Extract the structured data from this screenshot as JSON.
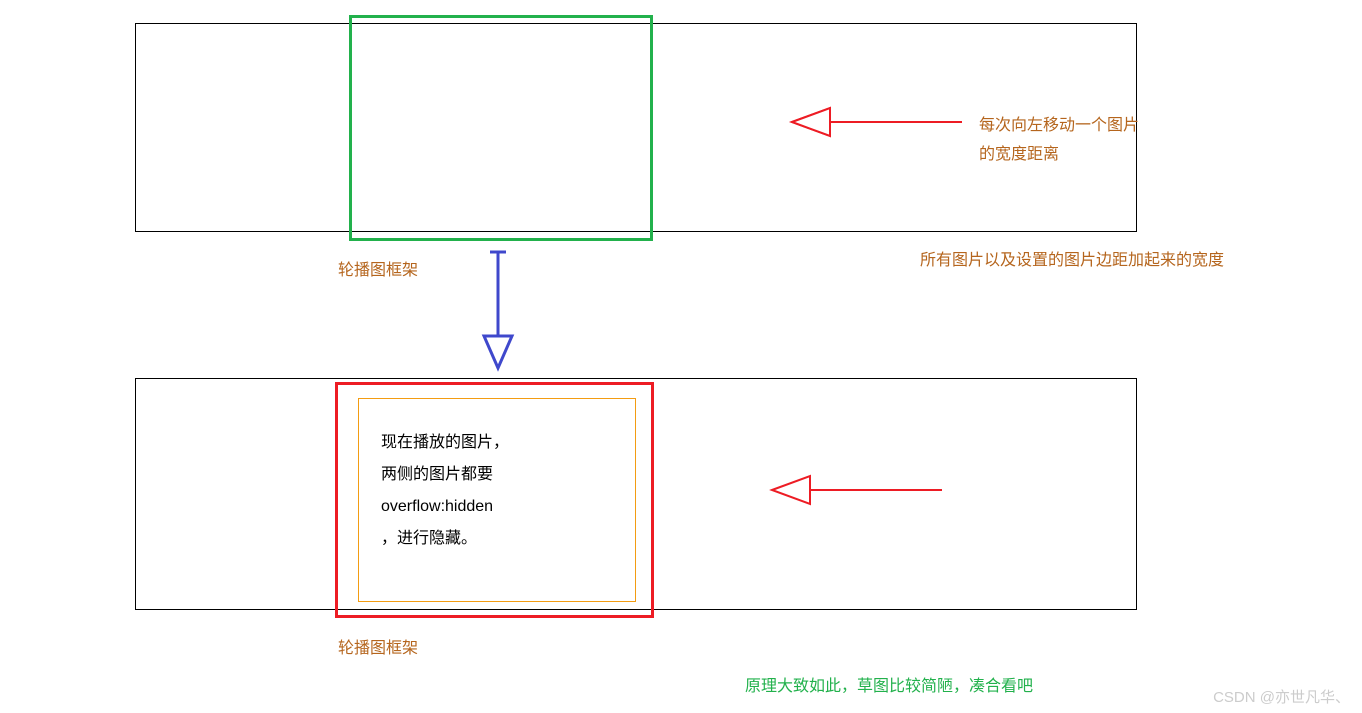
{
  "labels": {
    "carousel_frame_top": "轮播图框架",
    "carousel_frame_bottom": "轮播图框架",
    "move_left_desc": "每次向左移动一个图片的宽度距离",
    "full_width_desc": "所有图片以及设置的图片边距加起来的宽度"
  },
  "inner_note": {
    "line1": "现在播放的图片，",
    "line2": "两侧的图片都要",
    "line3": "overflow:hidden",
    "line4": "，进行隐藏。"
  },
  "green_note": "原理大致如此，草图比较简陋，凑合看吧",
  "watermark": "CSDN @亦世凡华、",
  "colors": {
    "green": "#22b14c",
    "red": "#ed1c24",
    "brown": "#b5651d",
    "orange": "#f39c12",
    "blue": "#3f48cc"
  }
}
